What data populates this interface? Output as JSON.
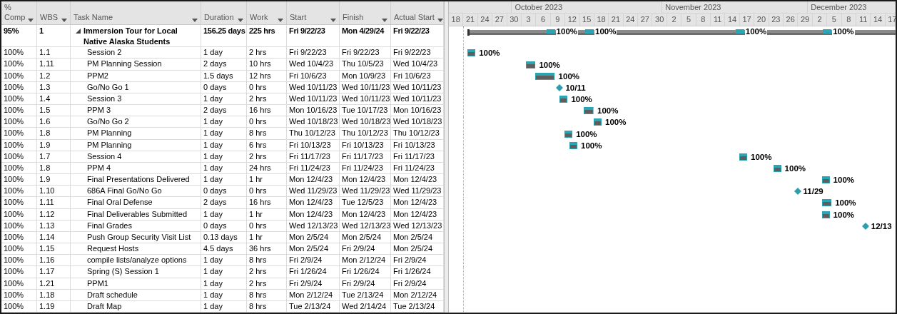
{
  "columns": [
    {
      "label": "% Comp"
    },
    {
      "label": "WBS"
    },
    {
      "label": "Task Name"
    },
    {
      "label": "Duration"
    },
    {
      "label": "Work"
    },
    {
      "label": "Start"
    },
    {
      "label": "Finish"
    },
    {
      "label": "Actual Start"
    }
  ],
  "timeline": {
    "months": [
      {
        "label": "October 2023"
      },
      {
        "label": "November 2023"
      },
      {
        "label": "December 2023"
      }
    ],
    "days": [
      "18",
      "21",
      "24",
      "27",
      "30",
      "3",
      "6",
      "9",
      "12",
      "15",
      "18",
      "21",
      "24",
      "27",
      "30",
      "2",
      "5",
      "8",
      "11",
      "14",
      "17",
      "20",
      "23",
      "26",
      "29",
      "2",
      "5",
      "8",
      "11",
      "14",
      "17"
    ]
  },
  "tasks": [
    {
      "kind": "summary",
      "pct": "95%",
      "wbs": "1",
      "name": "Immersion Tour for Local Native Alaska Students",
      "duration": "156.25 days",
      "work": "225 hrs",
      "start": "Fri 9/22/23",
      "finish": "Mon 4/29/24",
      "actual_start": "Fri 9/22/23",
      "expanded": true,
      "children": [
        {
          "kind": "task",
          "pct": "100%",
          "wbs": "1.1",
          "name": "Session 2",
          "duration": "1 day",
          "work": "2 hrs",
          "start": "Fri 9/22/23",
          "finish": "Fri 9/22/23",
          "actual_start": "Fri 9/22/23",
          "gantt_label": "100%"
        },
        {
          "kind": "task",
          "pct": "100%",
          "wbs": "1.11",
          "name": "PM Planning Session",
          "duration": "2 days",
          "work": "10 hrs",
          "start": "Wed 10/4/23",
          "finish": "Thu 10/5/23",
          "actual_start": "Wed 10/4/23",
          "gantt_label": "100%"
        },
        {
          "kind": "task",
          "pct": "100%",
          "wbs": "1.2",
          "name": "PPM2",
          "duration": "1.5 days",
          "work": "12 hrs",
          "start": "Fri 10/6/23",
          "finish": "Mon 10/9/23",
          "actual_start": "Fri 10/6/23",
          "gantt_label": "100%",
          "rollup_label": "100%"
        },
        {
          "kind": "milestone",
          "pct": "100%",
          "wbs": "1.3",
          "name": "Go/No Go 1",
          "duration": "0 days",
          "work": "0 hrs",
          "start": "Wed 10/11/23",
          "finish": "Wed 10/11/23",
          "actual_start": "Wed 10/11/23",
          "gantt_label": "10/11"
        },
        {
          "kind": "task",
          "pct": "100%",
          "wbs": "1.4",
          "name": "Session 3",
          "duration": "1 day",
          "work": "2 hrs",
          "start": "Wed 10/11/23",
          "finish": "Wed 10/11/23",
          "actual_start": "Wed 10/11/23",
          "gantt_label": "100%"
        },
        {
          "kind": "task",
          "pct": "100%",
          "wbs": "1.5",
          "name": "PPM 3",
          "duration": "2 days",
          "work": "16 hrs",
          "start": "Mon 10/16/23",
          "finish": "Tue 10/17/23",
          "actual_start": "Mon 10/16/23",
          "gantt_label": "100%",
          "rollup_label": "100%"
        },
        {
          "kind": "task",
          "pct": "100%",
          "wbs": "1.6",
          "name": "Go/No Go 2",
          "duration": "1 day",
          "work": "0 hrs",
          "start": "Wed 10/18/23",
          "finish": "Wed 10/18/23",
          "actual_start": "Wed 10/18/23",
          "gantt_label": "100%"
        },
        {
          "kind": "task",
          "pct": "100%",
          "wbs": "1.8",
          "name": "PM Planning",
          "duration": "1 day",
          "work": "8 hrs",
          "start": "Thu 10/12/23",
          "finish": "Thu 10/12/23",
          "actual_start": "Thu 10/12/23",
          "gantt_label": "100%"
        },
        {
          "kind": "task",
          "pct": "100%",
          "wbs": "1.9",
          "name": "PM Planning",
          "duration": "1 day",
          "work": "6 hrs",
          "start": "Fri 10/13/23",
          "finish": "Fri 10/13/23",
          "actual_start": "Fri 10/13/23",
          "gantt_label": "100%"
        },
        {
          "kind": "task",
          "pct": "100%",
          "wbs": "1.7",
          "name": "Session 4",
          "duration": "1 day",
          "work": "2 hrs",
          "start": "Fri 11/17/23",
          "finish": "Fri 11/17/23",
          "actual_start": "Fri 11/17/23",
          "gantt_label": "100%",
          "rollup_label": "100%"
        },
        {
          "kind": "task",
          "pct": "100%",
          "wbs": "1.8",
          "name": "PPM 4",
          "duration": "1 day",
          "work": "24 hrs",
          "start": "Fri 11/24/23",
          "finish": "Fri 11/24/23",
          "actual_start": "Fri 11/24/23",
          "gantt_label": "100%"
        },
        {
          "kind": "task",
          "pct": "100%",
          "wbs": "1.9",
          "name": "Final Presentations Delivered",
          "duration": "1 day",
          "work": "1 hr",
          "start": "Mon 12/4/23",
          "finish": "Mon 12/4/23",
          "actual_start": "Mon 12/4/23",
          "gantt_label": "100%"
        },
        {
          "kind": "milestone",
          "pct": "100%",
          "wbs": "1.10",
          "name": "686A Final Go/No Go",
          "duration": "0 days",
          "work": "0 hrs",
          "start": "Wed 11/29/23",
          "finish": "Wed 11/29/23",
          "actual_start": "Wed 11/29/23",
          "gantt_label": "11/29"
        },
        {
          "kind": "task",
          "pct": "100%",
          "wbs": "1.11",
          "name": "Final Oral Defense",
          "duration": "2 days",
          "work": "16 hrs",
          "start": "Mon 12/4/23",
          "finish": "Tue 12/5/23",
          "actual_start": "Mon 12/4/23",
          "gantt_label": "100%",
          "rollup_label": "100%"
        },
        {
          "kind": "task",
          "pct": "100%",
          "wbs": "1.12",
          "name": "Final Deliverables Submitted",
          "duration": "1 day",
          "work": "1 hr",
          "start": "Mon 12/4/23",
          "finish": "Mon 12/4/23",
          "actual_start": "Mon 12/4/23",
          "gantt_label": "100%"
        },
        {
          "kind": "milestone",
          "pct": "100%",
          "wbs": "1.13",
          "name": "Final Grades",
          "duration": "0 days",
          "work": "0 hrs",
          "start": "Wed 12/13/23",
          "finish": "Wed 12/13/23",
          "actual_start": "Wed 12/13/23",
          "gantt_label": "12/13"
        },
        {
          "kind": "task",
          "pct": "100%",
          "wbs": "1.14",
          "name": "Push Group Security Visit List",
          "duration": "0.13 days",
          "work": "1 hr",
          "start": "Mon 2/5/24",
          "finish": "Mon 2/5/24",
          "actual_start": "Mon 2/5/24"
        },
        {
          "kind": "task",
          "pct": "100%",
          "wbs": "1.15",
          "name": "Request Hosts",
          "duration": "4.5 days",
          "work": "36 hrs",
          "start": "Mon 2/5/24",
          "finish": "Fri 2/9/24",
          "actual_start": "Mon 2/5/24"
        },
        {
          "kind": "task",
          "pct": "100%",
          "wbs": "1.16",
          "name": "compile lists/analyze options",
          "duration": "1 day",
          "work": "8 hrs",
          "start": "Fri 2/9/24",
          "finish": "Mon 2/12/24",
          "actual_start": "Fri 2/9/24"
        },
        {
          "kind": "task",
          "pct": "100%",
          "wbs": "1.17",
          "name": "Spring (S) Session 1",
          "duration": "1 day",
          "work": "2 hrs",
          "start": "Fri 1/26/24",
          "finish": "Fri 1/26/24",
          "actual_start": "Fri 1/26/24"
        },
        {
          "kind": "task",
          "pct": "100%",
          "wbs": "1.21",
          "name": "PPM1",
          "duration": "1 day",
          "work": "2 hrs",
          "start": "Fri 2/9/24",
          "finish": "Fri 2/9/24",
          "actual_start": "Fri 2/9/24"
        },
        {
          "kind": "task",
          "pct": "100%",
          "wbs": "1.18",
          "name": "Draft schedule",
          "duration": "1 day",
          "work": "8 hrs",
          "start": "Mon 2/12/24",
          "finish": "Tue 2/13/24",
          "actual_start": "Mon 2/12/24"
        },
        {
          "kind": "task",
          "pct": "100%",
          "wbs": "1.19",
          "name": "Draft Map",
          "duration": "1 day",
          "work": "8 hrs",
          "start": "Tue 2/13/24",
          "finish": "Wed 2/14/24",
          "actual_start": "Tue 2/13/24"
        }
      ]
    }
  ]
}
